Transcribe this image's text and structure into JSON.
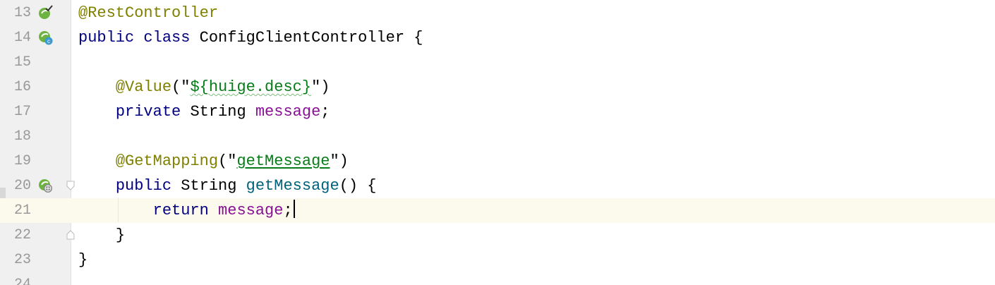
{
  "colors": {
    "annotation": "#808000",
    "keyword": "#000080",
    "string": "#067d17",
    "field": "#871094",
    "method": "#00627a",
    "line_number": "#999999",
    "current_line_bg": "#fcfaed",
    "gutter_bg": "#f0f0f0"
  },
  "gutter_icons": {
    "line13": "spring-bean-check-icon",
    "line14": "spring-bean-class-icon",
    "line20": "spring-web-endpoint-icon",
    "line20_fold": "fold-open-icon",
    "line22_fold": "fold-close-icon"
  },
  "lines": [
    {
      "num": "13",
      "t": {
        "a": "@RestController"
      }
    },
    {
      "num": "14",
      "t": {
        "kw1": "public",
        "kw2": "class",
        "name": "ConfigClientController",
        "brace": "{"
      }
    },
    {
      "num": "15"
    },
    {
      "num": "16",
      "t": {
        "anno": "@Value",
        "open": "(\"",
        "str": "${huige.desc}",
        "close": "\")"
      }
    },
    {
      "num": "17",
      "t": {
        "kw": "private",
        "type": "String",
        "field": "message",
        "semi": ";"
      }
    },
    {
      "num": "18"
    },
    {
      "num": "19",
      "t": {
        "anno": "@GetMapping",
        "open": "(\"",
        "str": "getMessage",
        "close": "\")"
      }
    },
    {
      "num": "20",
      "t": {
        "kw": "public",
        "type": "String",
        "method": "getMessage",
        "rest": "() {"
      }
    },
    {
      "num": "21",
      "t": {
        "kw": "return",
        "field": "message",
        "semi": ";"
      }
    },
    {
      "num": "22",
      "t": {
        "brace": "}"
      }
    },
    {
      "num": "23",
      "t": {
        "brace": "}"
      }
    },
    {
      "num": "24"
    }
  ]
}
